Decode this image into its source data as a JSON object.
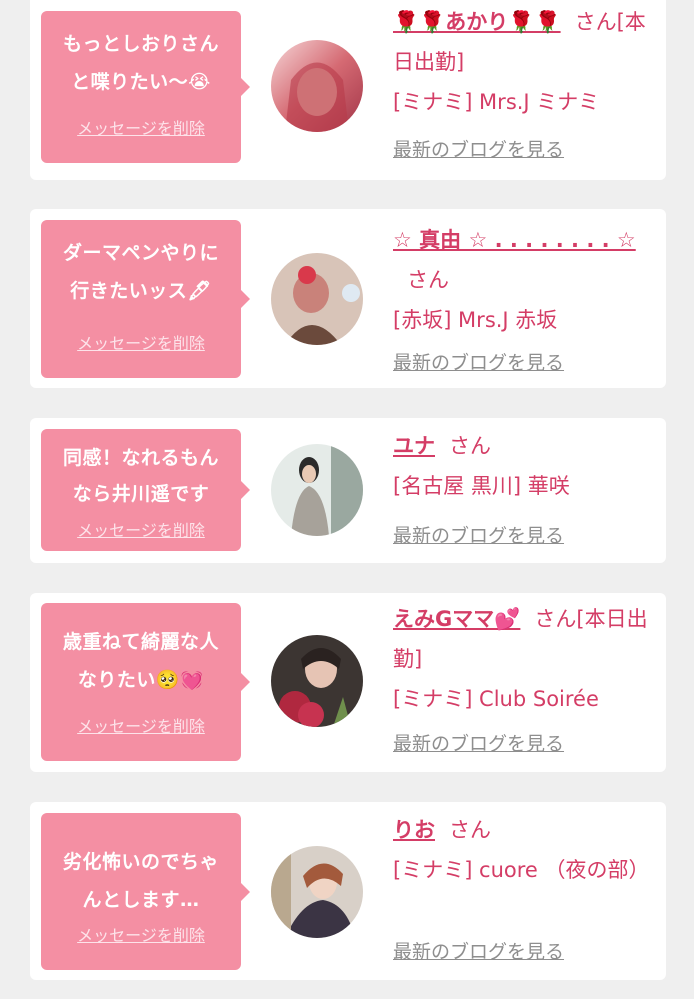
{
  "delete_label": "メッセージを削除",
  "blog_label": "最新のブログを見る",
  "honorific": "さん",
  "colors": {
    "background": "#efefef",
    "card": "#ffffff",
    "bubble": "#f48fa3",
    "accent_text": "#d43d66",
    "muted_text": "#8e8e8e"
  },
  "entries": [
    {
      "message": "もっとしおりさん\nと喋りたい〜😭",
      "name": "🌹🌹あかり🌹🌹",
      "status": "[本日出勤]",
      "shop": "[ミナミ] Mrs.J ミナミ"
    },
    {
      "message": "ダーマペンやりに\n行きたいッス🖋",
      "name": "☆ 真由 ☆ . . . . . . . . ☆",
      "status": "",
      "shop": "[赤坂] Mrs.J 赤坂"
    },
    {
      "message": "同感！なれるもん\nなら井川遥です",
      "name": "ユナ",
      "status": "",
      "shop": "[名古屋 黒川] 華咲"
    },
    {
      "message": "歳重ねて綺麗な人\nなりたい🥺💓",
      "name": "えみGママ💕",
      "status": "[本日出勤]",
      "shop": "[ミナミ] Club Soirée"
    },
    {
      "message": "劣化怖いのでちゃ\nんとします…",
      "name": "りお",
      "status": "",
      "shop": "[ミナミ] cuore （夜の部）"
    }
  ]
}
